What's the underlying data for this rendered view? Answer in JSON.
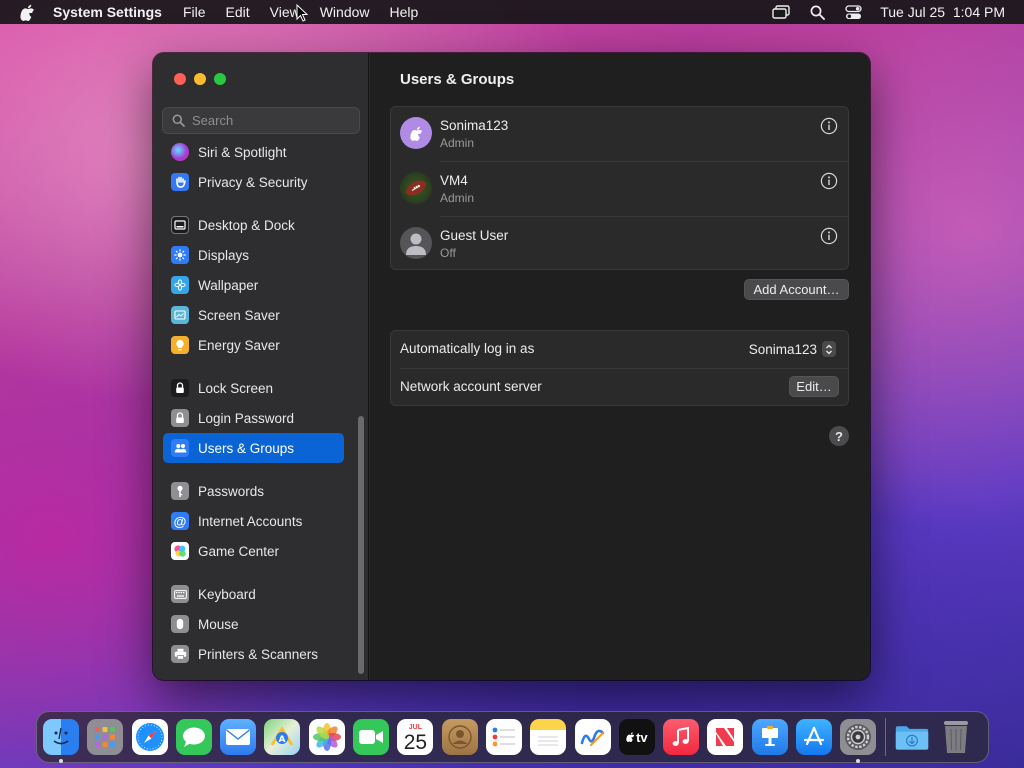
{
  "menubar": {
    "app_name": "System Settings",
    "items": [
      "File",
      "Edit",
      "View",
      "Window",
      "Help"
    ],
    "clock": "Tue Jul 25  1:04 PM"
  },
  "sidebar": {
    "search_placeholder": "Search",
    "items": [
      {
        "label": "Siri & Spotlight",
        "icon": "siri-icon",
        "color": "#c43cc8"
      },
      {
        "label": "Privacy & Security",
        "icon": "hand-icon",
        "color": "#3478f6"
      },
      {
        "label": "Desktop & Dock",
        "icon": "dock-icon",
        "color": "#1c1c1e"
      },
      {
        "label": "Displays",
        "icon": "sun-icon",
        "color": "#2f7cf6"
      },
      {
        "label": "Wallpaper",
        "icon": "flower-icon",
        "color": "#35a6e8"
      },
      {
        "label": "Screen Saver",
        "icon": "screensaver-icon",
        "color": "#5ab5d8"
      },
      {
        "label": "Energy Saver",
        "icon": "bulb-icon",
        "color": "#f4b02a"
      },
      {
        "label": "Lock Screen",
        "icon": "lock-icon",
        "color": "#1c1c1e"
      },
      {
        "label": "Login Password",
        "icon": "padlock-icon",
        "color": "#8e8e93"
      },
      {
        "label": "Users & Groups",
        "icon": "users-icon",
        "color": "#2f7cf6"
      },
      {
        "label": "Passwords",
        "icon": "key-icon",
        "color": "#8e8e93"
      },
      {
        "label": "Internet Accounts",
        "icon": "at-icon",
        "color": "#2f7cf6"
      },
      {
        "label": "Game Center",
        "icon": "gamecenter-icon",
        "color": "#ffffff"
      },
      {
        "label": "Keyboard",
        "icon": "keyboard-icon",
        "color": "#8e8e93"
      },
      {
        "label": "Mouse",
        "icon": "mouse-icon",
        "color": "#8e8e93"
      },
      {
        "label": "Printers & Scanners",
        "icon": "printer-icon",
        "color": "#8e8e93"
      }
    ],
    "active": "Users & Groups"
  },
  "main": {
    "title": "Users & Groups",
    "users": [
      {
        "name": "Sonima123",
        "role": "Admin"
      },
      {
        "name": "VM4",
        "role": "Admin"
      },
      {
        "name": "Guest User",
        "role": "Off"
      }
    ],
    "add_account": "Add Account…",
    "auto_login_label": "Automatically log in as",
    "auto_login_value": "Sonima123",
    "network_label": "Network account server",
    "edit_label": "Edit…",
    "help_label": "?"
  },
  "dock": {
    "apps": [
      {
        "icon": "finder-icon",
        "color": "#3a8ef6",
        "running": true
      },
      {
        "icon": "launchpad-icon",
        "color": "#9c9ca2",
        "running": false
      },
      {
        "icon": "safari-icon",
        "color": "#1e90ff",
        "running": false
      },
      {
        "icon": "messages-icon",
        "color": "#34c759",
        "running": false
      },
      {
        "icon": "mail-icon",
        "color": "#3d8bf5",
        "running": false
      },
      {
        "icon": "maps-icon",
        "color": "#5bb85b",
        "running": false
      },
      {
        "icon": "photos-icon",
        "color": "#ffffff",
        "running": false
      },
      {
        "icon": "facetime-icon",
        "color": "#34c759",
        "running": false
      },
      {
        "icon": "calendar-icon",
        "color": "#ffffff",
        "running": false
      },
      {
        "icon": "contacts-icon",
        "color": "#b58a5a",
        "running": false
      },
      {
        "icon": "reminders-icon",
        "color": "#ffffff",
        "running": false
      },
      {
        "icon": "notes-icon",
        "color": "#fbd44a",
        "running": false
      },
      {
        "icon": "freeform-icon",
        "color": "#ffffff",
        "running": false
      },
      {
        "icon": "tv-icon",
        "color": "#111111",
        "running": false
      },
      {
        "icon": "music-icon",
        "color": "#fa3c55",
        "running": false
      },
      {
        "icon": "news-icon",
        "color": "#ffffff",
        "running": false
      },
      {
        "icon": "keynote-icon",
        "color": "#2a8ef0",
        "running": false
      },
      {
        "icon": "appstore-icon",
        "color": "#1e8cf5",
        "running": false
      },
      {
        "icon": "settings-icon",
        "color": "#8e8e93",
        "running": true
      }
    ],
    "calendar_month": "JUL",
    "calendar_day": "25",
    "tv_label": "tv"
  }
}
